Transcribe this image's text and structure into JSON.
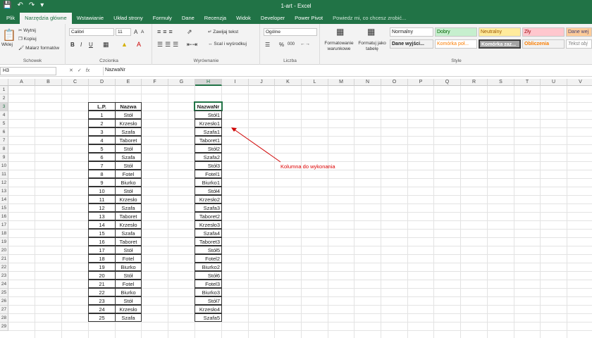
{
  "window": {
    "title": "1-art - Excel"
  },
  "tabs": [
    "Plik",
    "Narzędzia główne",
    "Wstawianie",
    "Układ strony",
    "Formuły",
    "Dane",
    "Recenzja",
    "Widok",
    "Developer",
    "Power Pivot",
    "Powiedz mi, co chcesz zrobić..."
  ],
  "active_tab": "Narzędzia główne",
  "ribbon": {
    "clipboard": {
      "label": "Schowek",
      "paste": "Wklej",
      "cut": "Wytnij",
      "copy": "Kopiuj",
      "format_painter": "Malarz formatów"
    },
    "font": {
      "label": "Czcionka",
      "name": "Calibri",
      "size": "11",
      "bold": "B",
      "italic": "I",
      "underline": "U",
      "grow": "A",
      "shrink": "A"
    },
    "alignment": {
      "label": "Wyrównanie",
      "wrap": "Zawijaj tekst",
      "merge": "Scal i wyśrodkuj"
    },
    "number": {
      "label": "Liczba",
      "format": "Ogólne",
      "percent": "%",
      "comma": "000"
    },
    "styles": {
      "label": "Style",
      "cond_format": "Formatowanie warunkowe",
      "format_table": "Formatuj jako tabelę",
      "cells": [
        "Normalny",
        "Dobry",
        "Neutralny",
        "Zły",
        "Dane wej",
        "Dane wyjści...",
        "Komórka poł...",
        "Komórka zaz...",
        "Obliczenia",
        "Tekst obj"
      ]
    }
  },
  "formula_bar": {
    "name_box": "H3",
    "fx": "fx",
    "content": "NazwaNr"
  },
  "columns": [
    "A",
    "B",
    "C",
    "D",
    "E",
    "F",
    "G",
    "H",
    "I",
    "J",
    "K",
    "L",
    "M",
    "N",
    "O",
    "P",
    "Q",
    "R",
    "S",
    "T",
    "U",
    "V"
  ],
  "rows": [
    "1",
    "2",
    "3",
    "4",
    "5",
    "6",
    "7",
    "8",
    "9",
    "10",
    "11",
    "12",
    "13",
    "14",
    "15",
    "16",
    "17",
    "18",
    "19",
    "20",
    "21",
    "22",
    "23",
    "24",
    "25",
    "26",
    "27",
    "28",
    "29"
  ],
  "table": {
    "headers": {
      "lp": "L.P.",
      "nazwa": "Nazwa",
      "nazwanr": "NazwaNr"
    },
    "rows": [
      [
        "1",
        "Stół",
        "Stół1"
      ],
      [
        "2",
        "Krzesło",
        "Krzesło1"
      ],
      [
        "3",
        "Szafa",
        "Szafa1"
      ],
      [
        "4",
        "Taboret",
        "Taboret1"
      ],
      [
        "5",
        "Stół",
        "Stół2"
      ],
      [
        "6",
        "Szafa",
        "Szafa2"
      ],
      [
        "7",
        "Stół",
        "Stół3"
      ],
      [
        "8",
        "Fotel",
        "Fotel1"
      ],
      [
        "9",
        "Biurko",
        "Biurko1"
      ],
      [
        "10",
        "Stół",
        "Stół4"
      ],
      [
        "11",
        "Krzesło",
        "Krzesło2"
      ],
      [
        "12",
        "Szafa",
        "Szafa3"
      ],
      [
        "13",
        "Taboret",
        "Taboret2"
      ],
      [
        "14",
        "Krzesło",
        "Krzesło3"
      ],
      [
        "15",
        "Szafa",
        "Szafa4"
      ],
      [
        "16",
        "Taboret",
        "Taboret3"
      ],
      [
        "17",
        "Stół",
        "Stół5"
      ],
      [
        "18",
        "Fotel",
        "Fotel2"
      ],
      [
        "19",
        "Biurko",
        "Biurko2"
      ],
      [
        "20",
        "Stół",
        "Stół6"
      ],
      [
        "21",
        "Fotel",
        "Fotel3"
      ],
      [
        "22",
        "Biurko",
        "Biurko3"
      ],
      [
        "23",
        "Stół",
        "Stół7"
      ],
      [
        "24",
        "Krzesło",
        "Krzesło4"
      ],
      [
        "25",
        "Szafa",
        "Szafa5"
      ]
    ]
  },
  "annotation": {
    "text": "Kolumna do wykonania",
    "color": "#d00000"
  },
  "colors": {
    "accent": "#217346"
  }
}
